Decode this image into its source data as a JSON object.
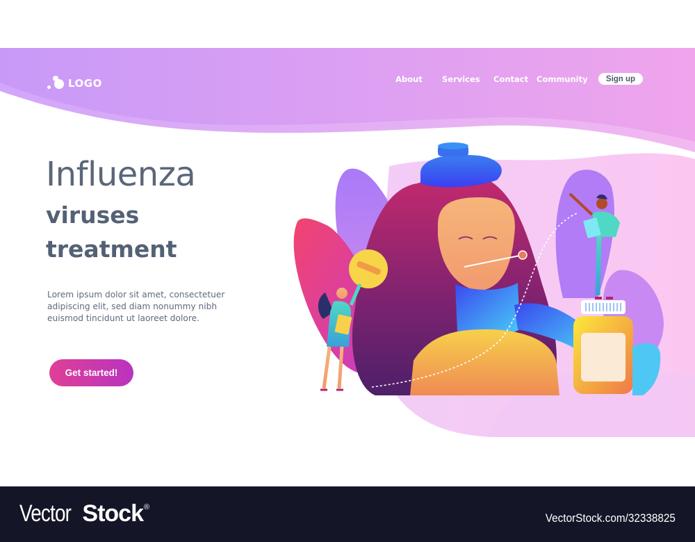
{
  "header": {
    "logo_text": "LOGO",
    "nav": [
      {
        "label": "About"
      },
      {
        "label": "Services"
      },
      {
        "label": "Contact"
      },
      {
        "label": "Community"
      }
    ],
    "signup_label": "Sign up"
  },
  "hero": {
    "title_line1": "Influenza",
    "title_line2": "viruses",
    "title_line3": "treatment",
    "description": "Lorem ipsum dolor sit amet, consectetuer adipiscing elit, sed diam nonummy nibh euismod tincidunt ut laoreet dolore.",
    "cta_label": "Get started!"
  },
  "illustration": {
    "subject": "sick woman with ice bag, thermometer and scarf; doctors with pill and medicine bottle"
  },
  "footer": {
    "brand_light": "Vector",
    "brand_bold": "Stock",
    "brand_mark": "®",
    "stock_id": "VectorStock.com/32338825"
  },
  "colors": {
    "header_gradient_start": "#c79bf7",
    "header_gradient_end": "#eea4ea",
    "text_dark": "#546175",
    "cta_start": "#df3f96",
    "cta_end": "#b834bf",
    "footer_bg": "#141627"
  }
}
